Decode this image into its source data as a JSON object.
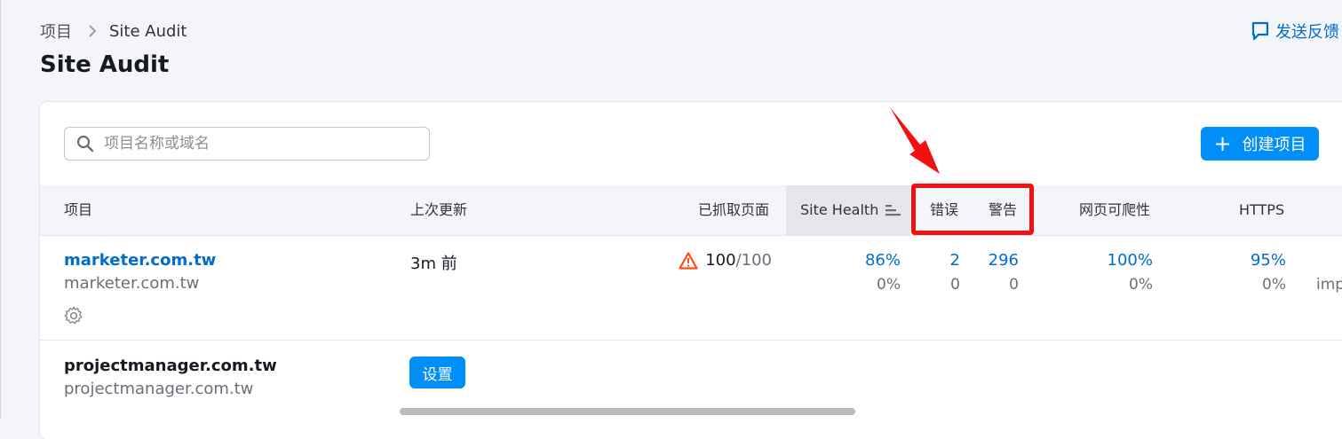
{
  "breadcrumb": {
    "root": "项目",
    "current": "Site Audit"
  },
  "page_title": "Site Audit",
  "feedback_label": "发送反馈",
  "search": {
    "placeholder": "项目名称或域名"
  },
  "create_button": "创建项目",
  "columns": {
    "project": "项目",
    "last_update": "上次更新",
    "crawled_pages": "已抓取页面",
    "site_health": "Site Health",
    "errors": "错误",
    "warnings": "警告",
    "crawlability": "网页可爬性",
    "https": "HTTPS"
  },
  "rows": [
    {
      "name": "marketer.com.tw",
      "domain": "marketer.com.tw",
      "updated": "3m 前",
      "crawled": "100",
      "limit": "/100",
      "site_health": "86%",
      "site_health_delta": "0%",
      "errors": "2",
      "errors_delta": "0",
      "warnings": "296",
      "warnings_delta": "0",
      "crawlability": "100%",
      "crawlability_delta": "0%",
      "https": "95%",
      "https_delta": "0%",
      "clipped_text": "imp"
    },
    {
      "name": "projectmanager.com.tw",
      "domain": "projectmanager.com.tw",
      "setup_button": "设置"
    }
  ],
  "colors": {
    "accent": "#008ff8",
    "link": "#006dca",
    "highlight": "#f21010",
    "warning": "#ff4b13"
  }
}
